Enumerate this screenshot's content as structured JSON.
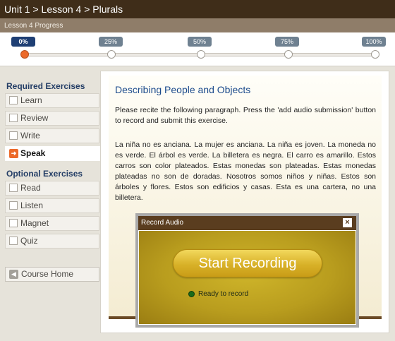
{
  "header": {
    "breadcrumb": "Unit 1 > Lesson 4 > Plurals"
  },
  "progress": {
    "title": "Lesson 4 Progress",
    "value_percent": 0,
    "markers": [
      "0%",
      "25%",
      "50%",
      "75%",
      "100%"
    ]
  },
  "sidebar": {
    "required_title": "Required Exercises",
    "required": [
      {
        "label": "Learn"
      },
      {
        "label": "Review"
      },
      {
        "label": "Write"
      },
      {
        "label": "Speak",
        "active": true
      }
    ],
    "optional_title": "Optional Exercises",
    "optional": [
      {
        "label": "Read"
      },
      {
        "label": "Listen"
      },
      {
        "label": "Magnet"
      },
      {
        "label": "Quiz"
      }
    ],
    "home_label": "Course Home"
  },
  "exercise": {
    "title": "Describing People and Objects",
    "instructions": "Please recite the following paragraph. Press the 'add audio submission' button to record and submit this exercise.",
    "paragraph": "La niña no es anciana. La mujer es anciana. La niña es joven. La moneda no es verde. El árbol es verde. La billetera es negra. El carro es amarillo. Estos carros son color plateados. Estas monedas son plateadas. Estas monedas plateadas no son de doradas. Nosotros somos niños y niñas. Estos son árboles y flores. Estos son edificios y casas. Esta es una cartera, no una billetera."
  },
  "record_dialog": {
    "title": "Record Audio",
    "close_glyph": "×",
    "button_label": "Start Recording",
    "status": "Ready to record"
  },
  "colors": {
    "header": "#3f2d19",
    "accent": "#ec6a2a",
    "link": "#1c4b8c",
    "record": "#d8b128"
  },
  "icons": {
    "active_item": "arrow-right-icon",
    "home": "home-icon",
    "close": "close-icon",
    "status": "status-dot-icon"
  }
}
